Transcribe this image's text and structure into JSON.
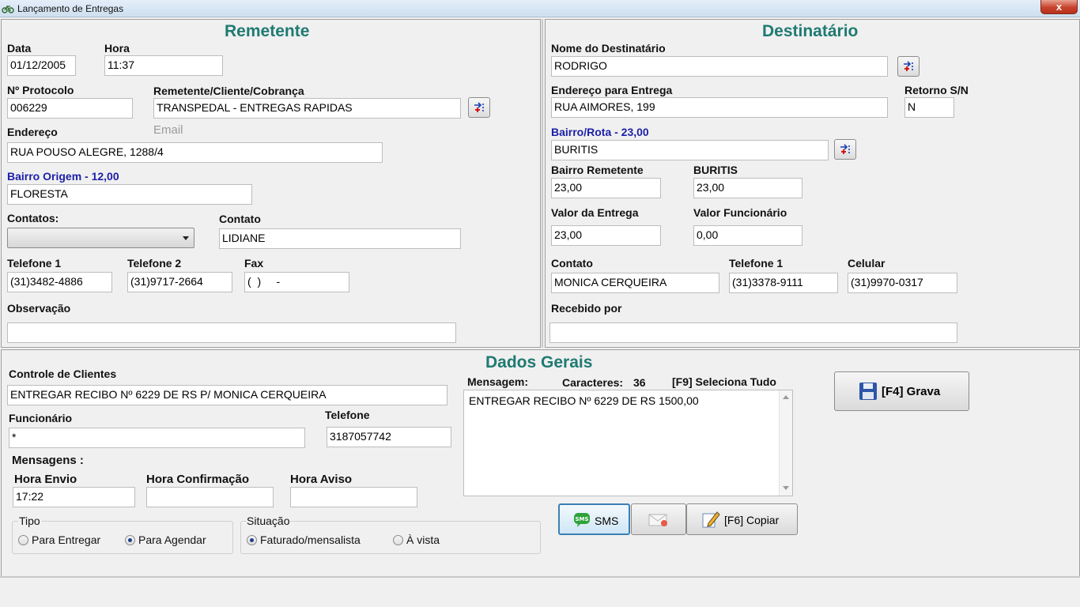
{
  "window": {
    "title": "Lançamento de Entregas",
    "close": "x"
  },
  "remetente": {
    "section_title": "Remetente",
    "data_label": "Data",
    "data_value": "01/12/2005",
    "hora_label": "Hora",
    "hora_value": "11:37",
    "protocolo_label": "Nº Protocolo",
    "protocolo_value": "006229",
    "cliente_label": "Remetente/Cliente/Cobrança",
    "cliente_value": "TRANSPEDAL - ENTREGAS RAPIDAS",
    "endereco_label": "Endereço",
    "email_label": "Email",
    "endereco_value": "RUA POUSO ALEGRE, 1288/4",
    "bairro_label": "Bairro Origem - 12,00",
    "bairro_value": "FLORESTA",
    "contatos_label": "Contatos:",
    "contatos_value": "",
    "contato_label": "Contato",
    "contato_value": "LIDIANE",
    "tel1_label": "Telefone 1",
    "tel1_value": "(31)3482-4886",
    "tel2_label": "Telefone 2",
    "tel2_value": "(31)9717-2664",
    "fax_label": "Fax",
    "fax_value": "(  )     -",
    "obs_label": "Observação",
    "obs_value": ""
  },
  "destinatario": {
    "section_title": "Destinatário",
    "nome_label": "Nome do Destinatário",
    "nome_value": "RODRIGO",
    "endereco_label": "Endereço para Entrega",
    "endereco_value": "RUA AIMORES, 199",
    "retorno_label": "Retorno S/N",
    "retorno_value": "N",
    "bairro_label": "Bairro/Rota - 23,00",
    "bairro_value": "BURITIS",
    "bairro_rem_label": "Bairro Remetente",
    "bairro_rem_value": "23,00",
    "buritis_label": "BURITIS",
    "buritis_value": "23,00",
    "valor_entrega_label": "Valor da Entrega",
    "valor_entrega_value": "23,00",
    "valor_func_label": "Valor Funcionário",
    "valor_func_value": "0,00",
    "contato_label": "Contato",
    "contato_value": "MONICA CERQUEIRA",
    "tel1_label": "Telefone 1",
    "tel1_value": "(31)3378-9111",
    "celular_label": "Celular",
    "celular_value": "(31)9970-0317",
    "recebido_label": "Recebido por",
    "recebido_value": ""
  },
  "gerais": {
    "section_title": "Dados Gerais",
    "controle_label": "Controle de Clientes",
    "controle_value": "ENTREGAR RECIBO Nº 6229 DE RS P/ MONICA CERQUEIRA",
    "func_label": "Funcionário",
    "func_value": "*",
    "telefone_label": "Telefone",
    "telefone_value": "3187057742",
    "mensagens_label": "Mensagens :",
    "hora_envio_label": "Hora Envio",
    "hora_envio_value": "17:22",
    "hora_conf_label": "Hora Confirmação",
    "hora_conf_value": "",
    "hora_aviso_label": "Hora Aviso",
    "hora_aviso_value": "",
    "tipo_label": "Tipo",
    "tipo_opt1": "Para Entregar",
    "tipo_opt2": "Para Agendar",
    "situacao_label": "Situação",
    "sit_opt1": "Faturado/mensalista",
    "sit_opt2": "À vista",
    "mensagem_label": "Mensagem:",
    "caracteres_label": "Caracteres:",
    "caracteres_value": "36",
    "seleciona_label": "[F9] Seleciona Tudo",
    "mensagem_value": "ENTREGAR RECIBO Nº 6229 DE RS 1500,00",
    "sms_label": "SMS",
    "copiar_label": "[F6] Copiar",
    "grava_label": "[F4] Grava"
  },
  "icons": [
    "bicycle-icon",
    "lookup-icon",
    "sms-icon",
    "email-icon",
    "edit-icon",
    "save-disk-icon"
  ],
  "colors": {
    "section_title": "#1f7a72",
    "blue_label": "#1c1fa8",
    "close_red": "#c8432c"
  }
}
